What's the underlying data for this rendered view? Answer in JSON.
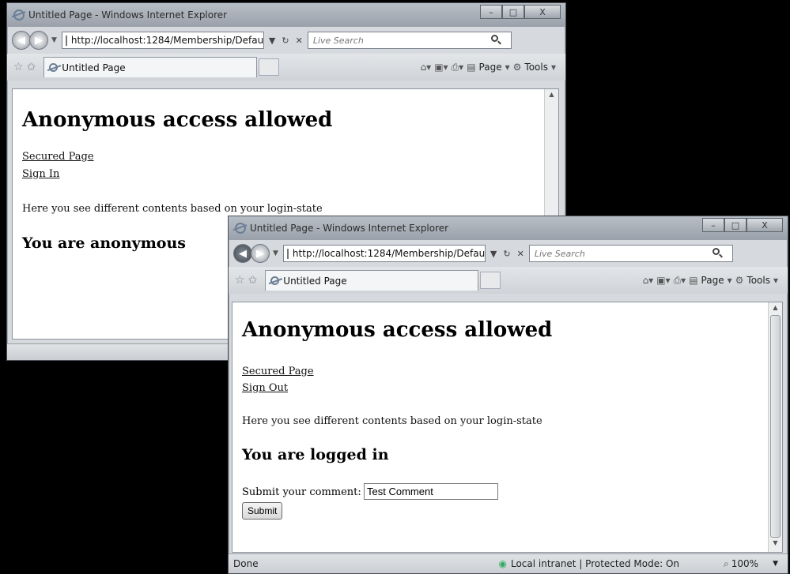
{
  "back_window": {
    "title": "Untitled Page - Windows Internet Explorer",
    "controls": [
      "–",
      "□",
      "X"
    ],
    "address": "http://localhost:1284/Membership/Defau",
    "search_placeholder": "Live Search",
    "tab_title": "Untitled Page",
    "cmd_page": "Page",
    "cmd_tools": "Tools",
    "heading": "Anonymous access allowed",
    "link_secured": "Secured Page",
    "link_sign": "Sign In",
    "info": "Here you see different contents based on your login-state",
    "status_heading": "You are anonymous"
  },
  "front_window": {
    "title": "Untitled Page - Windows Internet Explorer",
    "controls": [
      "–",
      "□",
      "X"
    ],
    "address": "http://localhost:1284/Membership/Defau",
    "search_placeholder": "Live Search",
    "tab_title": "Untitled Page",
    "cmd_page": "Page",
    "cmd_tools": "Tools",
    "heading": "Anonymous access allowed",
    "link_secured": "Secured Page",
    "link_sign": "Sign Out",
    "info": "Here you see different contents based on your login-state",
    "status_heading": "You are logged in",
    "comment_label": "Submit your comment:",
    "comment_value": "Test Comment",
    "submit_label": "Submit",
    "status_text": "Done",
    "zone": "Local intranet | Protected Mode: On",
    "zoom": "100%"
  }
}
